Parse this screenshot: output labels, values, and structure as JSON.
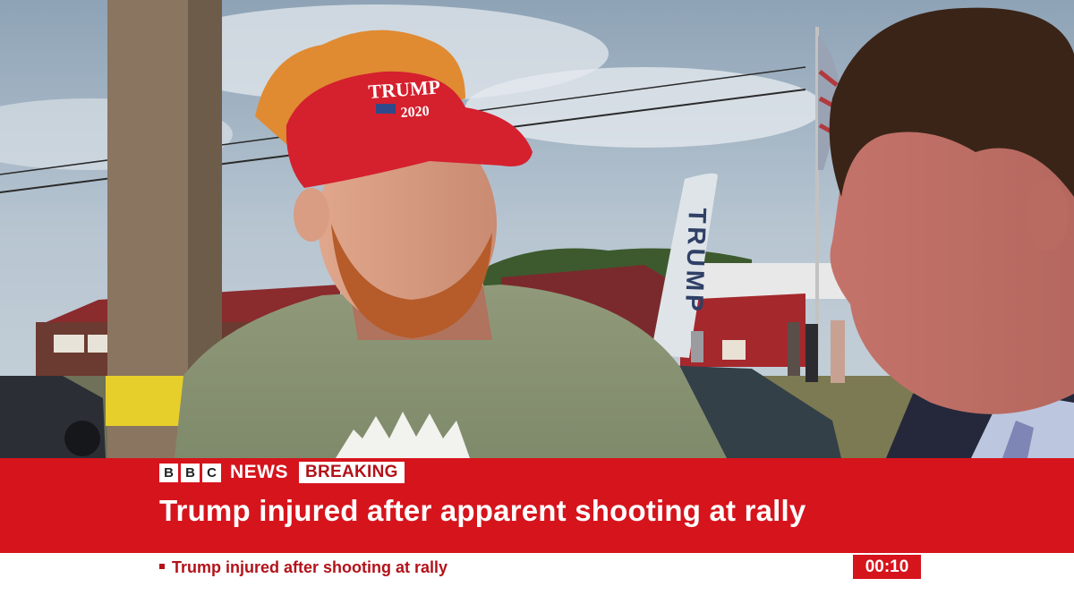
{
  "scene": {
    "cap_text": "TRUMP",
    "cap_year": "2020",
    "banner_text": "TRUMP"
  },
  "broadcast": {
    "bbc_letters": [
      "B",
      "B",
      "C"
    ],
    "news_label": "NEWS",
    "breaking_label": "BREAKING",
    "headline": "Trump injured after apparent shooting at rally",
    "ticker": "Trump injured after shooting at rally",
    "clock": "00:10"
  },
  "colors": {
    "bbc_red": "#d6141c",
    "cap_red": "#d5202e"
  }
}
